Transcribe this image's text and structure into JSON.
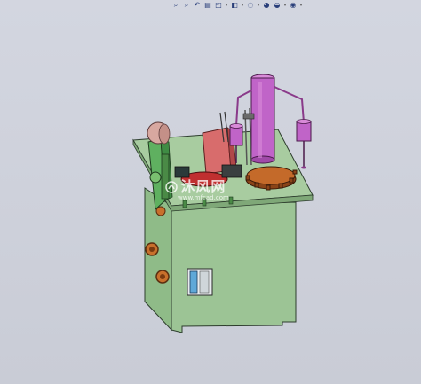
{
  "toolbar": {
    "items": [
      {
        "name": "zoom-to-fit",
        "glyph": "⌕"
      },
      {
        "name": "zoom-area",
        "glyph": "⌕"
      },
      {
        "name": "previous-view",
        "glyph": "↶"
      },
      {
        "name": "section-view",
        "glyph": "▤"
      },
      {
        "name": "view-orientation",
        "glyph": "◰"
      },
      {
        "name": "display-style",
        "glyph": "◧"
      },
      {
        "name": "hide-show-items",
        "glyph": "◌"
      },
      {
        "name": "edit-appearance",
        "glyph": "◕"
      },
      {
        "name": "apply-scene",
        "glyph": "◒"
      },
      {
        "name": "view-settings",
        "glyph": "◉"
      }
    ]
  },
  "watermark": {
    "title": "沐风网",
    "subtitle": "www.mfcad.com"
  },
  "colors": {
    "background": "#cdd0da",
    "cabinet": "#9cc495",
    "cabinet_dark": "#6f9a6a",
    "column": "#c064c8",
    "motor": "#d86c6c",
    "turntable": "#c46a2a",
    "roller": "#d8a8a0"
  }
}
